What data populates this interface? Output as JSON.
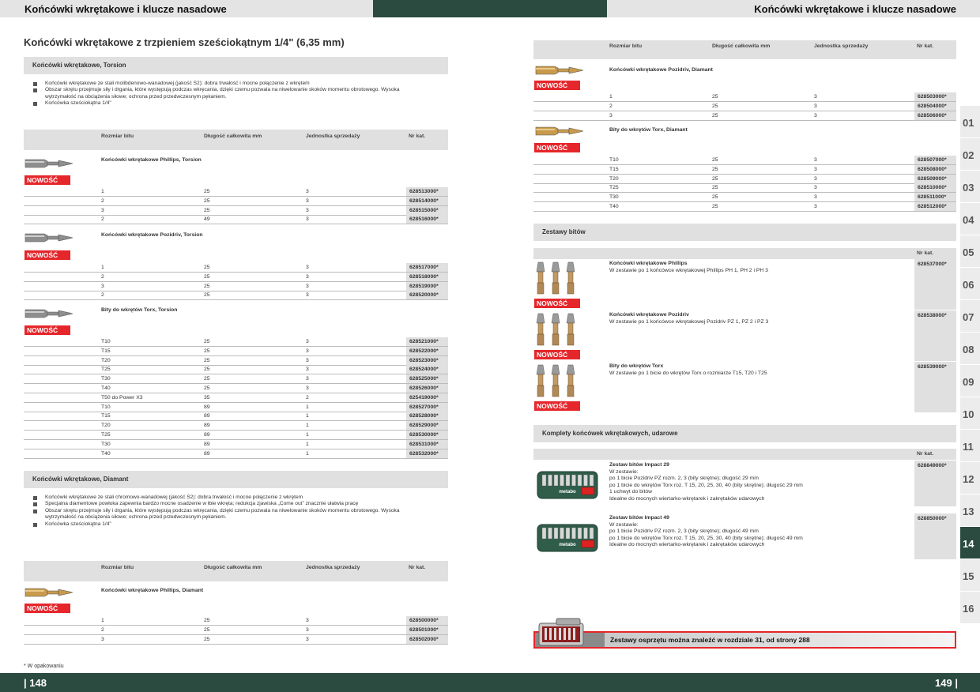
{
  "header": {
    "left_title": "Końcówki wkrętakowe i klucze nasadowe",
    "right_title": "Końcówki wkrętakowe i klucze nasadowe"
  },
  "footer": {
    "left_page": "| 148",
    "right_page": "149 |",
    "note": "* W opakowaniu"
  },
  "index_tabs": [
    "01",
    "02",
    "03",
    "04",
    "05",
    "06",
    "07",
    "08",
    "09",
    "10",
    "11",
    "12",
    "13",
    "14",
    "15",
    "16"
  ],
  "active_tab": "14",
  "badge": "NOWOŚĆ",
  "columns": {
    "size": "Rozmiar bitu",
    "length": "Długość całkowita mm",
    "unit": "Jednostka sprzedaży",
    "cat": "Nr kat.",
    "cat_only": "Nr kat."
  },
  "left": {
    "title": "Końcówki wkrętakowe z trzpieniem sześciokątnym 1/4\" (6,35 mm)",
    "torsion": {
      "heading": "Końcówki wkrętakowe, Torsion",
      "bullets": [
        "Końcówki wkrętakowe ze stali molibdenowo-wanadowej (jakość S2): dobra trwałość i mocne połączenie z wkrętem",
        "Obszar skrętu przejmuje siły i drgania, które występują podczas wkręcania, dzięki czemu pozwala na niwelowanie skoków momentu obrotowego. Wysoka wytrzymałość na obciążenia siłowe; ochrona przed przedwczesnym pękaniem.",
        "Końcówka sześciokątna 1/4\""
      ],
      "groups": [
        {
          "name": "Końcówki wkrętakowe Phillips, Torsion",
          "rows": [
            {
              "size": "1",
              "len": "25",
              "unit": "3",
              "cat": "628513000*"
            },
            {
              "size": "2",
              "len": "25",
              "unit": "3",
              "cat": "628514000*"
            },
            {
              "size": "3",
              "len": "25",
              "unit": "3",
              "cat": "628515000*"
            },
            {
              "size": "2",
              "len": "49",
              "unit": "3",
              "cat": "628516000*"
            }
          ]
        },
        {
          "name": "Końcówki wkrętakowe Pozidriv, Torsion",
          "rows": [
            {
              "size": "1",
              "len": "25",
              "unit": "3",
              "cat": "628517000*"
            },
            {
              "size": "2",
              "len": "25",
              "unit": "3",
              "cat": "628518000*"
            },
            {
              "size": "3",
              "len": "25",
              "unit": "3",
              "cat": "628519000*"
            },
            {
              "size": "2",
              "len": "25",
              "unit": "3",
              "cat": "628520000*"
            }
          ]
        },
        {
          "name": "Bity do wkrętów Torx, Torsion",
          "rows": [
            {
              "size": "T10",
              "len": "25",
              "unit": "3",
              "cat": "628521000*"
            },
            {
              "size": "T15",
              "len": "25",
              "unit": "3",
              "cat": "628522000*"
            },
            {
              "size": "T20",
              "len": "25",
              "unit": "3",
              "cat": "628523000*"
            },
            {
              "size": "T25",
              "len": "25",
              "unit": "3",
              "cat": "628524000*"
            },
            {
              "size": "T30",
              "len": "25",
              "unit": "3",
              "cat": "628525000*"
            },
            {
              "size": "T40",
              "len": "25",
              "unit": "3",
              "cat": "628526000*"
            },
            {
              "size": "T50 do Power X3",
              "len": "35",
              "unit": "2",
              "cat": "625419000*"
            },
            {
              "size": "T10",
              "len": "89",
              "unit": "1",
              "cat": "628527000*"
            },
            {
              "size": "T15",
              "len": "89",
              "unit": "1",
              "cat": "628528000*"
            },
            {
              "size": "T20",
              "len": "89",
              "unit": "1",
              "cat": "628529000*"
            },
            {
              "size": "T25",
              "len": "89",
              "unit": "1",
              "cat": "628530000*"
            },
            {
              "size": "T30",
              "len": "89",
              "unit": "1",
              "cat": "628531000*"
            },
            {
              "size": "T40",
              "len": "89",
              "unit": "1",
              "cat": "628532000*"
            }
          ]
        }
      ]
    },
    "diamant": {
      "heading": "Końcówki wkrętakowe, Diamant",
      "bullets": [
        "Końcówki wkrętakowe ze stali chromowo-wanadowej (jakość S2): dobra trwałość i mocne połączenie z wkrętem",
        "Specjalna diamentowe powłoka zapewnia bardzo mocne osadzenie w łbie wkręta; redukcja zjawiska „Come out” znacznie ułatwia pracę",
        "Obszar skrętu przejmuje siły i drgania, które występują podczas wkręcania, dzięki czemu pozwala na niwelowanie skoków momentu obrotowego. Wysoka wytrzymałość na obciążenia siłowe; ochrona przed przedwczesnym pękaniem.",
        "Końcówka sześciokątna 1/4\""
      ],
      "groups": [
        {
          "name": "Końcówki wkrętakowe Phillips, Diamant",
          "rows": [
            {
              "size": "1",
              "len": "25",
              "unit": "3",
              "cat": "628500000*"
            },
            {
              "size": "2",
              "len": "25",
              "unit": "3",
              "cat": "628501000*"
            },
            {
              "size": "3",
              "len": "25",
              "unit": "3",
              "cat": "628502000*"
            }
          ]
        }
      ]
    }
  },
  "right": {
    "groups": [
      {
        "name": "Końcówki wkrętakowe Pozidriv, Diamant",
        "rows": [
          {
            "size": "1",
            "len": "25",
            "unit": "3",
            "cat": "628503000*"
          },
          {
            "size": "2",
            "len": "25",
            "unit": "3",
            "cat": "628504000*"
          },
          {
            "size": "3",
            "len": "25",
            "unit": "3",
            "cat": "628506000*"
          }
        ]
      },
      {
        "name": "Bity do wkrętów Torx, Diamant",
        "rows": [
          {
            "size": "T10",
            "len": "25",
            "unit": "3",
            "cat": "628507000*"
          },
          {
            "size": "T15",
            "len": "25",
            "unit": "3",
            "cat": "628508000*"
          },
          {
            "size": "T20",
            "len": "25",
            "unit": "3",
            "cat": "628509000*"
          },
          {
            "size": "T25",
            "len": "25",
            "unit": "3",
            "cat": "628510000*"
          },
          {
            "size": "T30",
            "len": "25",
            "unit": "3",
            "cat": "628511000*"
          },
          {
            "size": "T40",
            "len": "25",
            "unit": "3",
            "cat": "628512000*"
          }
        ]
      }
    ],
    "bit_sets": {
      "heading": "Zestawy bitów",
      "items": [
        {
          "name": "Końcówki wkrętakowe Phillips",
          "desc": "W zestawie po 1 końcówce wkrętakowej Phillips PH 1, PH 2 i PH 3",
          "cat": "628537000*"
        },
        {
          "name": "Końcówki wkrętakowe Pozidriv",
          "desc": "W zestawie po 1 końcówce wkrętakowej Pozidriv PZ 1, PZ 2 i PZ 3",
          "cat": "628538000*"
        },
        {
          "name": "Bity do wkrętów Torx",
          "desc": "W zestawie po 1 bicie do wkrętów Torx o rozmiarze T15, T20 i T25",
          "cat": "628539000*"
        }
      ]
    },
    "impact_sets": {
      "heading": "Komplety końcówek wkrętakowych, udarowe",
      "items": [
        {
          "name": "Zestaw bitów Impact 29",
          "lines": [
            "W zestawie:",
            "po 1 bicie Pozidriv PZ rozm. 2, 3 (bity skrętne); długość 29 mm",
            "po 1 bicie do wkrętów Torx roz. T 15, 20, 25, 30, 40 (bity skrętne); długość 29 mm",
            "1 uchwyt do bitów",
            "Idealne do mocnych wiertarko-wkrętarek i zakrętaków udarowych"
          ],
          "cat": "628849000*",
          "brand": "metabo"
        },
        {
          "name": "Zestaw bitów Impact 49",
          "lines": [
            "W zestawie:",
            "po 1 bicie Pozidriv PZ rozm. 2, 3 (bity skrętne); długość 49 mm",
            "po 1 bicie do wkrętów Torx roz. T 15, 20, 25, 30, 40 (bity skrętne); długość 49 mm",
            "Idealne do mocnych wiertarko-wkrętarek i zakrętaków udarowych"
          ],
          "cat": "628850000*",
          "brand": "metabo"
        }
      ]
    },
    "promo": "Zestawy osprzętu można znaleźć w rozdziale 31, od strony 288"
  },
  "colors": {
    "brand_green": "#2b4a40",
    "badge_red": "#e5262b",
    "grey_bar": "#e0e0e0"
  }
}
